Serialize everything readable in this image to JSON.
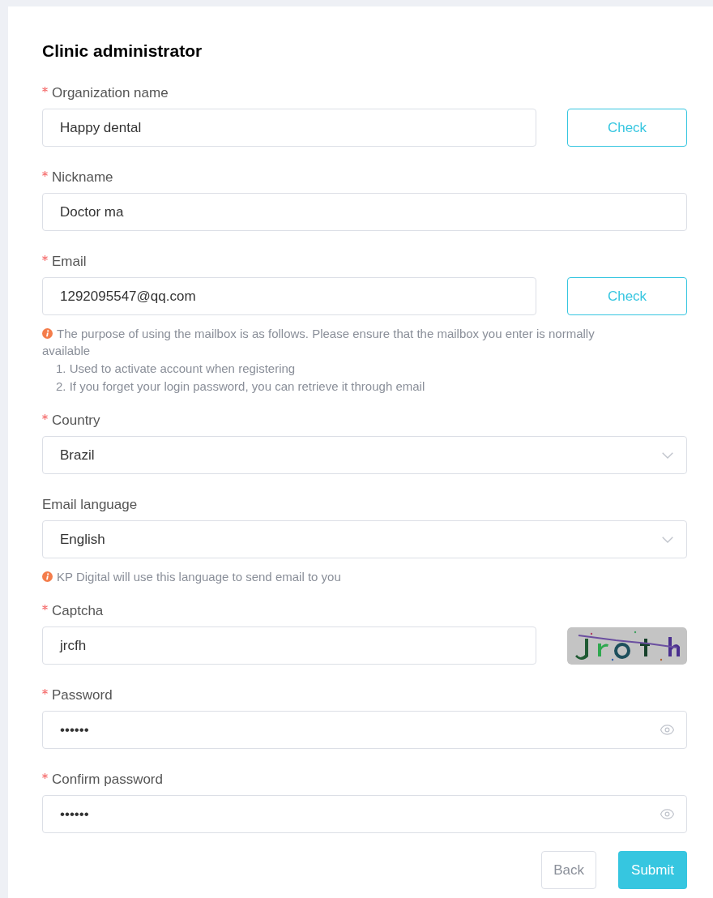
{
  "title": "Clinic administrator",
  "fields": [
    {
      "kind": "text",
      "label": "Organization name",
      "required": true,
      "value": "Happy dental",
      "action": "Check"
    },
    {
      "kind": "text",
      "label": "Nickname",
      "required": true,
      "value": "Doctor ma"
    },
    {
      "kind": "text",
      "label": "Email",
      "required": true,
      "value": "1292095547@qq.com",
      "action": "Check",
      "note": {
        "text": "The purpose of using the mailbox is as follows. Please ensure that the mailbox you enter is normally available",
        "items": [
          "1. Used to activate account when registering",
          "2. If you forget your login password, you can retrieve it through email"
        ]
      }
    },
    {
      "kind": "select",
      "label": "Country",
      "required": true,
      "value": "Brazil"
    },
    {
      "kind": "select",
      "label": "Email language",
      "required": false,
      "value": "English",
      "note": {
        "text": "KP Digital will use this language to send email to you"
      }
    },
    {
      "kind": "captcha",
      "label": "Captcha",
      "required": true,
      "value": "jrcfh"
    },
    {
      "kind": "password",
      "label": "Password",
      "required": true,
      "value": "••••••"
    },
    {
      "kind": "password",
      "label": "Confirm password",
      "required": true,
      "value": "••••••"
    }
  ],
  "buttons": [
    {
      "label": "Back",
      "kind": "secondary"
    },
    {
      "label": "Submit",
      "kind": "primary"
    }
  ]
}
